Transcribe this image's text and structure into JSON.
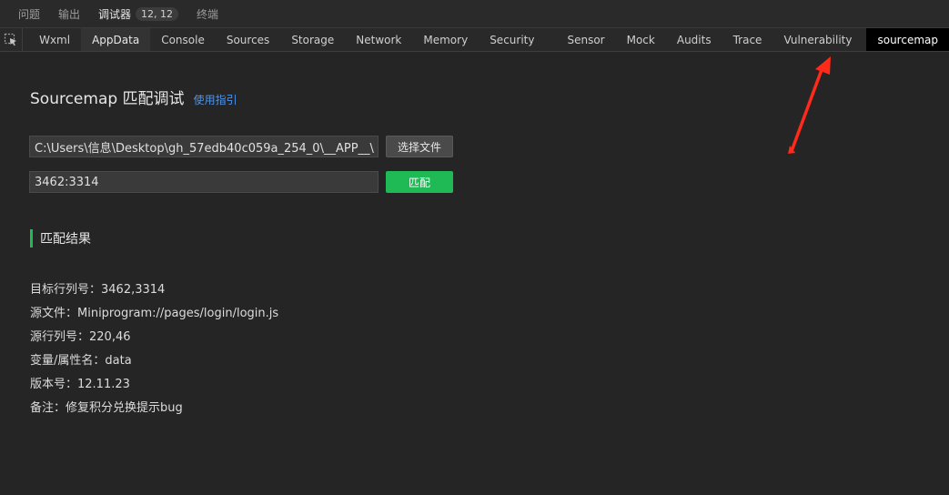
{
  "panel_tabs": {
    "problems": "问题",
    "output": "输出",
    "debugger": "调试器",
    "badge": "12, 12",
    "terminal": "终端"
  },
  "tool_tabs": [
    "Wxml",
    "AppData",
    "Console",
    "Sources",
    "Storage",
    "Network",
    "Memory",
    "Security",
    "Sensor",
    "Mock",
    "Audits",
    "Trace",
    "Vulnerability",
    "sourcemap"
  ],
  "active_tool_tab": "sourcemap",
  "page": {
    "title": "Sourcemap 匹配调试",
    "guide_link": "使用指引",
    "path_value": "C:\\Users\\信息\\Desktop\\gh_57edb40c059a_254_0\\__APP__\\",
    "select_file_button": "选择文件",
    "position_value": "3462:3314",
    "match_button": "匹配",
    "result_heading": "匹配结果",
    "results": [
      "目标行列号：3462,3314",
      "源文件：Miniprogram://pages/login/login.js",
      "源行列号：220,46",
      "变量/属性名：data",
      "版本号：12.11.23",
      "备注：修复积分兑换提示bug"
    ]
  },
  "colors": {
    "accent_green": "#1fba55",
    "link_blue": "#4f94e8",
    "annotation_red": "#ff2a1a"
  }
}
